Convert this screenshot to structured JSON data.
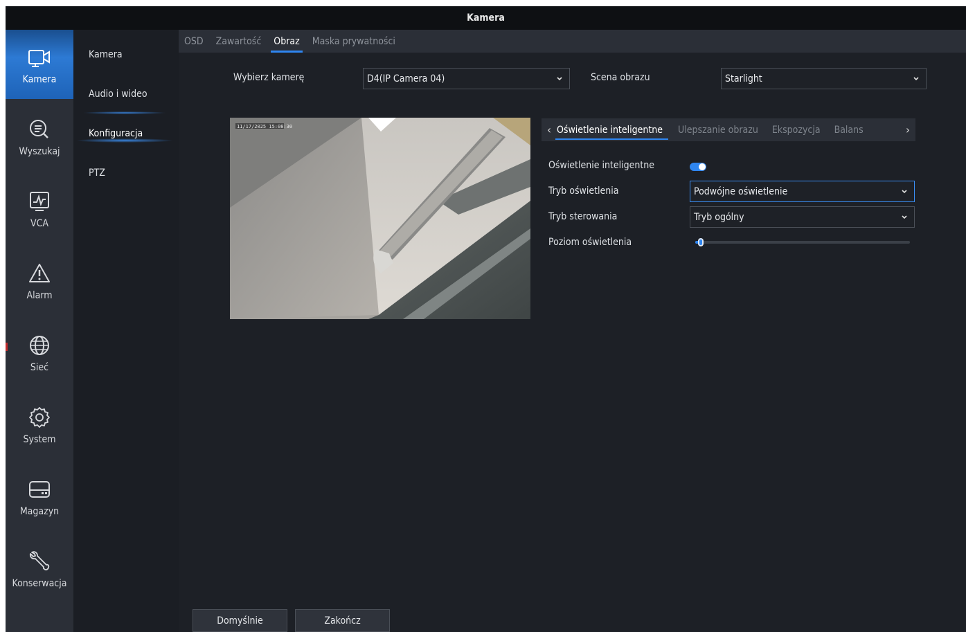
{
  "window": {
    "title": "Kamera"
  },
  "nav": {
    "items": [
      {
        "label": "Kamera",
        "icon": "camera-icon",
        "active": true
      },
      {
        "label": "Wyszukaj",
        "icon": "search-icon"
      },
      {
        "label": "VCA",
        "icon": "vca-chart-icon"
      },
      {
        "label": "Alarm",
        "icon": "alarm-warning-icon"
      },
      {
        "label": "Sieć",
        "icon": "globe-icon"
      },
      {
        "label": "System",
        "icon": "gear-icon"
      },
      {
        "label": "Magazyn",
        "icon": "hard-drive-icon"
      },
      {
        "label": "Konserwacja",
        "icon": "wrench-icon"
      }
    ]
  },
  "subnav": {
    "items": [
      {
        "label": "Kamera"
      },
      {
        "label": "Audio i wideo"
      },
      {
        "label": "Konfiguracja",
        "active": true
      },
      {
        "label": "PTZ"
      }
    ]
  },
  "tabs": [
    {
      "label": "OSD"
    },
    {
      "label": "Zawartość"
    },
    {
      "label": "Obraz",
      "active": true
    },
    {
      "label": "Maska prywatności"
    }
  ],
  "form": {
    "camera_label": "Wybierz kamerę",
    "camera_value": "D4(IP Camera 04)",
    "scene_label": "Scena obrazu",
    "scene_value": "Starlight"
  },
  "preview": {
    "timestamp": "11/17/2025 15:08:30"
  },
  "subtabs": [
    {
      "label": "Oświetlenie inteligentne",
      "active": true
    },
    {
      "label": "Ulepszanie obrazu"
    },
    {
      "label": "Ekspozycja"
    },
    {
      "label": "Balans"
    }
  ],
  "settings": {
    "smart_light_label": "Oświetlenie inteligentne",
    "smart_light_on": true,
    "light_mode_label": "Tryb oświetlenia",
    "light_mode_value": "Podwójne oświetlenie",
    "control_mode_label": "Tryb sterowania",
    "control_mode_value": "Tryb ogólny",
    "light_level_label": "Poziom oświetlenia",
    "light_level_fraction": 0.02
  },
  "buttons": {
    "default": "Domyślnie",
    "exit": "Zakończ"
  },
  "colors": {
    "accent": "#2f86f0",
    "background": "#1d2026",
    "sidebar": "#2b2f37"
  }
}
